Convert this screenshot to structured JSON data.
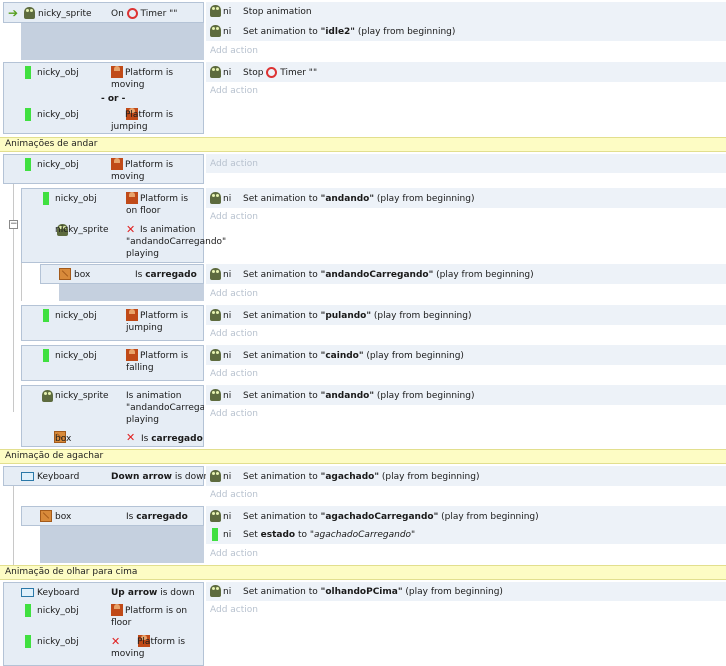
{
  "events": {
    "e1": {
      "cond_object": "nicky_sprite",
      "cond_text_prefix": "On",
      "cond_text_suffix": "Timer \"\"",
      "a1_obj": "ni",
      "a1_text": "Stop animation",
      "a2_obj": "ni",
      "a2_prefix": "Set animation to ",
      "a2_value": "\"idle2\"",
      "a2_suffix": " (play from beginning)"
    },
    "e2": {
      "c1_object": "nicky_obj",
      "c1_text": "Platform is moving",
      "or_label": "- or -",
      "c2_object": "nicky_obj",
      "c2_text": "Platform is jumping",
      "a1_obj": "ni",
      "a1_prefix": "Stop",
      "a1_suffix": "Timer \"\""
    },
    "g1": {
      "title": "Animações de andar"
    },
    "e3": {
      "c_object": "nicky_obj",
      "c_text": "Platform is moving"
    },
    "e4": {
      "c1_object": "nicky_obj",
      "c1_text": "Platform is on floor",
      "c2_object": "nicky_sprite",
      "c2_text": "Is animation \"andandoCarregando\" playing",
      "a_obj": "ni",
      "a_prefix": "Set animation to ",
      "a_value": "\"andando\"",
      "a_suffix": " (play from beginning)"
    },
    "e5": {
      "c_object": "box",
      "c_prefix": "Is ",
      "c_value": "carregado",
      "a_obj": "ni",
      "a_prefix": "Set animation to ",
      "a_value": "\"andandoCarregando\"",
      "a_suffix": " (play from beginning)"
    },
    "e6": {
      "c_object": "nicky_obj",
      "c_text": "Platform is jumping",
      "a_obj": "ni",
      "a_prefix": "Set animation to ",
      "a_value": "\"pulando\"",
      "a_suffix": " (play from beginning)"
    },
    "e7": {
      "c_object": "nicky_obj",
      "c_text": "Platform is falling",
      "a_obj": "ni",
      "a_prefix": "Set animation to ",
      "a_value": "\"caindo\"",
      "a_suffix": " (play from beginning)"
    },
    "e8": {
      "c1_object": "nicky_sprite",
      "c1_text": "Is animation \"andandoCarregando\" playing",
      "c2_object": "box",
      "c2_prefix": "Is ",
      "c2_value": "carregado",
      "a_obj": "ni",
      "a_prefix": "Set animation to ",
      "a_value": "\"andando\"",
      "a_suffix": " (play from beginning)"
    },
    "g2": {
      "title": "Animação de agachar"
    },
    "e9": {
      "c_object": "Keyboard",
      "c_value": "Down arrow",
      "c_suffix": " is down",
      "a_obj": "ni",
      "a_prefix": "Set animation to ",
      "a_value": "\"agachado\"",
      "a_suffix": " (play from beginning)"
    },
    "e10": {
      "c_object": "box",
      "c_prefix": "Is ",
      "c_value": "carregado",
      "a1_obj": "ni",
      "a1_prefix": "Set animation to ",
      "a1_value": "\"agachadoCarregando\"",
      "a1_suffix": " (play from beginning)",
      "a2_obj": "ni",
      "a2_prefix": "Set ",
      "a2_value": "estado",
      "a2_mid": " to ",
      "a2_italic": "\"agachadoCarregando\""
    },
    "g3": {
      "title": "Animação de olhar para cima"
    },
    "e11": {
      "c1_object": "Keyboard",
      "c1_value": "Up arrow",
      "c1_suffix": " is down",
      "c2_object": "nicky_obj",
      "c2_text": "Platform is on floor",
      "c3_object": "nicky_obj",
      "c3_text": "Platform is moving",
      "a_obj": "ni",
      "a_prefix": "Set animation to ",
      "a_value": "\"olhandoPCima\"",
      "a_suffix": " (play from beginning)"
    }
  },
  "add_action_label": "Add action",
  "icons": {
    "object_sprite": "frog-sprite-icon",
    "object_family": "green-bar-icon",
    "behavior": "platform-behavior-icon",
    "box": "box-sprite-icon",
    "keyboard": "keyboard-icon",
    "timer": "timer-icon",
    "invert": "invert-x-icon",
    "trigger": "trigger-arrow-icon"
  },
  "colors": {
    "group_bg": "#fdfcc4",
    "condition_bg": "#e6edf5",
    "action_bg": "#edf2f8",
    "add_action_text": "#b8c2cf"
  }
}
